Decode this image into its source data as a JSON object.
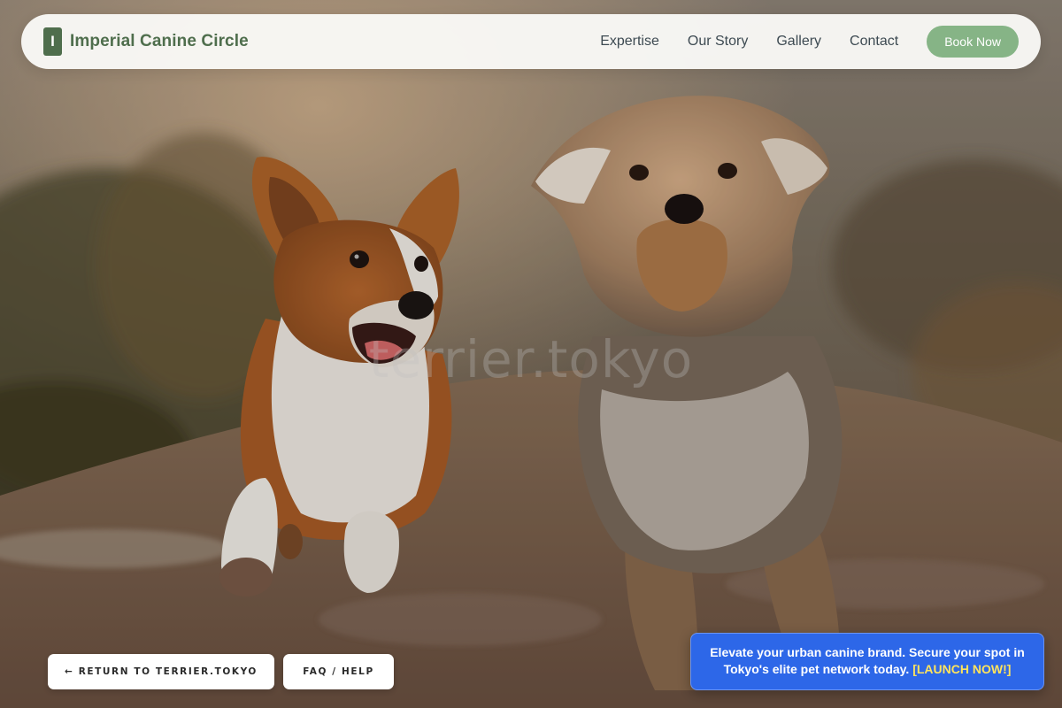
{
  "brand": {
    "mark": "I",
    "name": "Imperial Canine Circle"
  },
  "nav": {
    "items": [
      {
        "label": "Expertise"
      },
      {
        "label": "Our Story"
      },
      {
        "label": "Gallery"
      },
      {
        "label": "Contact"
      }
    ],
    "cta_label": "Book Now"
  },
  "hero": {
    "watermark": "terrier.tokyo",
    "image_subject": "corgi and terrier running on a dirt path at sunset"
  },
  "footer_links": {
    "return_label": "← RETURN TO TERRIER.TOKYO",
    "faq_label": "FAQ / HELP"
  },
  "promo": {
    "text": "Elevate your urban canine brand. Secure your spot in Tokyo's elite pet network today.",
    "cta": "[LAUNCH NOW!]"
  },
  "colors": {
    "brand_green": "#4f6e4d",
    "cta_green": "#86b486",
    "promo_blue": "#2d67e8",
    "promo_cta_yellow": "#ffe45c"
  }
}
